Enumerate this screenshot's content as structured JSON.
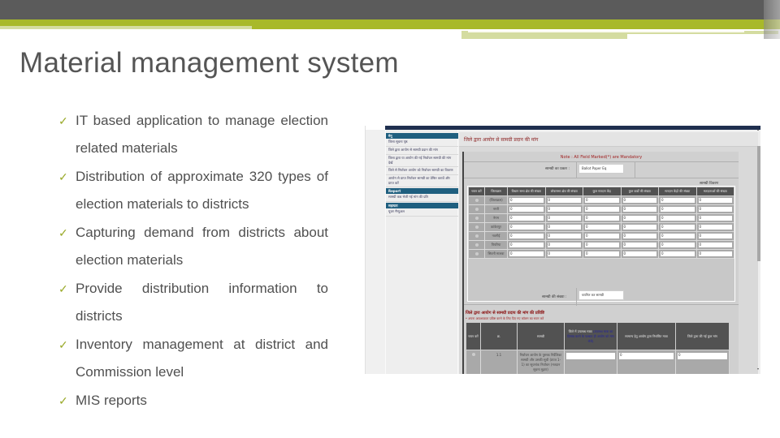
{
  "slide": {
    "title": "Material management system",
    "bullets": [
      "IT based application to manage election related materials",
      "Distribution of approximate 320 types of election materials to districts",
      "Capturing demand from districts about election materials",
      "Provide distribution information to districts",
      "Inventory management at district and Commission level",
      "MIS reports"
    ],
    "bullet_icon": "check-mark-icon",
    "accent_color": "#a8b92a",
    "header_color": "#5b5b5b"
  },
  "screenshot": {
    "sidebar": {
      "sections": [
        {
          "label": "मेनू",
          "items": [
            "जिला सूचना पृष्ठ",
            "जिले द्वारा आयोग से सामग्री प्रदान की मांग",
            "जिला द्वारा या आयोग की गई निर्वाचन सामग्री की मांग देखें",
            "जिले से निर्वाचन आयोग को निर्वाचन सामग्री का विवरण",
            "आयोग से प्राप्त निर्वाचन सामग्री का प्रेषित करावें और प्राप्त करें"
          ]
        },
        {
          "label": "Report",
          "items": [
            "सामग्री कब भेजी गई मांग की प्रति"
          ]
        },
        {
          "label": "सहायता",
          "items": [
            "यूजर मैन्युअल"
          ]
        }
      ]
    },
    "page_title": "जिले द्वारा आयोग से सामग्री प्रदान की मांग",
    "note": "Note : All Field Marked(*) are Mandatory",
    "material_label": "सामग्री का प्रकार :",
    "material_value": "Ballot Paper Eq",
    "grid1": {
      "caption": "सामग्री विवरण",
      "headers": [
        "चयन करें",
        "जिलाक्रम",
        "विधान सभा क्षेत्र की संख्या",
        "लोकसभा क्षेत्र की संख्या",
        "कुल मतदान केंद्र",
        "कुल वार्डों की संख्या",
        "मतदान केंद्रों की संख्या",
        "मतदाताओं की संख्या"
      ],
      "rows": [
        {
          "name": "(जिलाक्रम)",
          "values": [
            "0",
            "0",
            "0",
            "0",
            "0",
            "0"
          ]
        },
        {
          "name": "नगरी",
          "values": [
            "0",
            "0",
            "0",
            "0",
            "0",
            "0"
          ]
        },
        {
          "name": "नेगम",
          "values": [
            "0",
            "0",
            "0",
            "0",
            "0",
            "0"
          ]
        },
        {
          "name": "कांकेरपुर",
          "values": [
            "0",
            "0",
            "0",
            "0",
            "0",
            "0"
          ]
        },
        {
          "name": "नवनीई",
          "values": [
            "0",
            "0",
            "0",
            "0",
            "0",
            "0"
          ]
        },
        {
          "name": "पिपरिया",
          "values": [
            "0",
            "0",
            "0",
            "0",
            "0",
            "0"
          ]
        },
        {
          "name": "सिवनी मालवा",
          "values": [
            "0",
            "0",
            "0",
            "0",
            "0",
            "0"
          ]
        }
      ]
    },
    "quantity_label": "सामग्री की संख्या :",
    "quantity_value": "चयनित कर सामग्री",
    "grid2": {
      "title": "जिले द्वारा आयोग से सामग्री प्रदाय की मांग की प्रविष्टि",
      "subtitle": "* अपना आवश्यकता प्रविष्ट करने के लिए दिए गए कॉलम का चयन करें",
      "headers": [
        "चयन करें",
        "क्र.",
        "सामग्री",
        "जिले में उपलब्ध मात्रा (उपलब्ध मात्रा का हिसाब करने के पश्चात ही आयोग को मांग भेजें)",
        "सामान्य हेतु आयोग द्वारा निर्धारित मात्रा",
        "जिले द्वारा की गई कुल मांग"
      ],
      "blue_header_part": "(उपलब्ध मात्रा का हिसाब करने के पश्चात ही आयोग को मांग भेजें)",
      "rows": [
        {
          "num": "1.1",
          "material": "निर्वाचन आयोग के पुस्तक निर्देशिका सामग्री और उसकी सूची (प्रपत्र 1-1) का सूचनांक निर्वाचन (मतदान सूचना मुद्रण)",
          "available": "",
          "fixed": "0",
          "demand": "0"
        }
      ]
    }
  }
}
